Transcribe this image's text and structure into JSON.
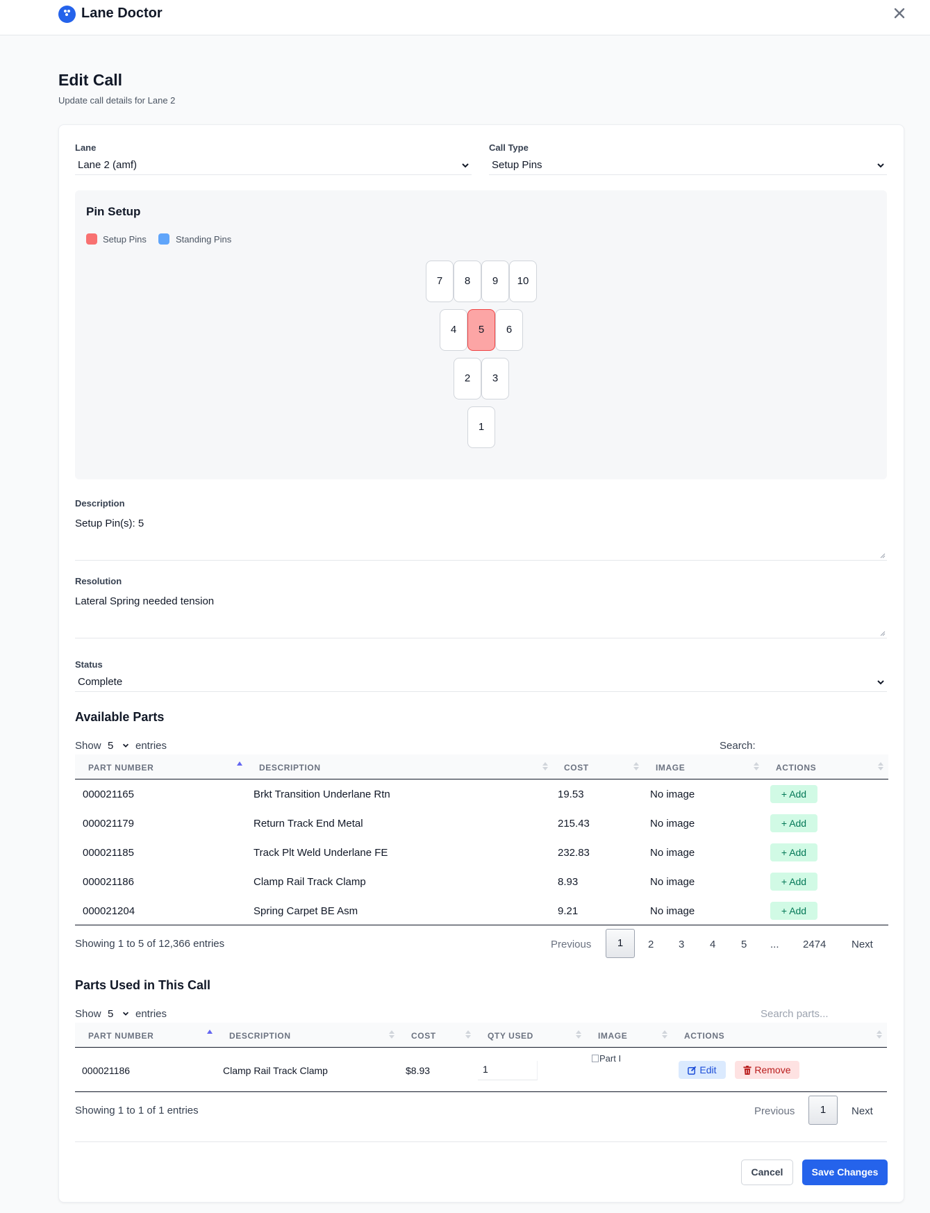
{
  "app": {
    "title": "Lane Doctor"
  },
  "page": {
    "title": "Edit Call",
    "subtitle": "Update call details for Lane 2"
  },
  "form": {
    "lane_label": "Lane",
    "lane_value": "Lane 2 (amf)",
    "call_type_label": "Call Type",
    "call_type_value": "Setup Pins",
    "description_label": "Description",
    "description_value": "Setup Pin(s): 5",
    "resolution_label": "Resolution",
    "resolution_value": "Lateral Spring needed tension",
    "status_label": "Status",
    "status_value": "Complete"
  },
  "pin_setup": {
    "title": "Pin Setup",
    "legend": {
      "setup": "Setup Pins",
      "standing": "Standing Pins"
    },
    "colors": {
      "setup": "#f87171",
      "standing": "#60a5fa"
    },
    "pins": [
      "1",
      "2",
      "3",
      "4",
      "5",
      "6",
      "7",
      "8",
      "9",
      "10"
    ],
    "selected_setup_pins": [
      "5"
    ]
  },
  "available_parts": {
    "title": "Available Parts",
    "show": "Show",
    "page_size": "5",
    "entries": "entries",
    "search_label": "Search:",
    "columns": [
      "PART NUMBER",
      "DESCRIPTION",
      "COST",
      "IMAGE",
      "ACTIONS"
    ],
    "rows": [
      {
        "part": "000021165",
        "desc": "Brkt Transition Underlane Rtn",
        "cost": "19.53",
        "image": "No image",
        "action": "Add"
      },
      {
        "part": "000021179",
        "desc": "Return Track End Metal",
        "cost": "215.43",
        "image": "No image",
        "action": "Add"
      },
      {
        "part": "000021185",
        "desc": "Track Plt Weld Underlane FE",
        "cost": "232.83",
        "image": "No image",
        "action": "Add"
      },
      {
        "part": "000021186",
        "desc": "Clamp Rail Track Clamp",
        "cost": "8.93",
        "image": "No image",
        "action": "Add"
      },
      {
        "part": "000021204",
        "desc": "Spring Carpet BE Asm",
        "cost": "9.21",
        "image": "No image",
        "action": "Add"
      }
    ],
    "info": "Showing 1 to 5 of 12,366 entries",
    "pagination": {
      "previous": "Previous",
      "pages": [
        "1",
        "2",
        "3",
        "4",
        "5",
        "...",
        "2474"
      ],
      "next": "Next",
      "current": "1"
    }
  },
  "parts_used": {
    "title": "Parts Used in This Call",
    "show": "Show",
    "page_size": "5",
    "entries": "entries",
    "search_placeholder": "Search parts...",
    "columns": [
      "PART NUMBER",
      "DESCRIPTION",
      "COST",
      "QTY USED",
      "IMAGE",
      "ACTIONS"
    ],
    "rows": [
      {
        "part": "000021186",
        "desc": "Clamp Rail Track Clamp",
        "cost": "$8.93",
        "qty": "1",
        "image_alt": "Part I",
        "edit": "Edit",
        "remove": "Remove"
      }
    ],
    "info": "Showing 1 to 1 of 1 entries",
    "pagination": {
      "previous": "Previous",
      "current": "1",
      "next": "Next"
    }
  },
  "buttons": {
    "cancel": "Cancel",
    "save": "Save Changes"
  }
}
